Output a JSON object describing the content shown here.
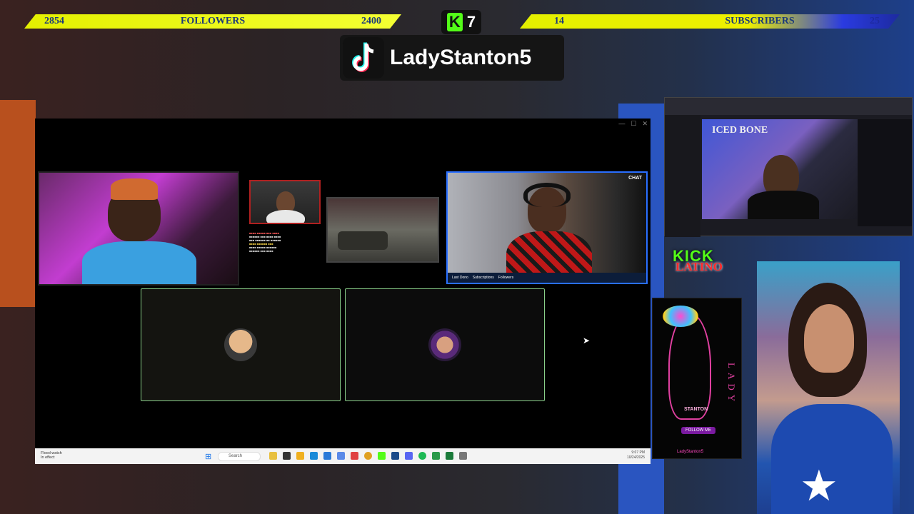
{
  "overlay": {
    "followers_banner": {
      "count_left": "2854",
      "label": "FOLLOWERS",
      "count_right": "2400"
    },
    "kick_badge": {
      "count": "7"
    },
    "subscribers_banner": {
      "count_left": "14",
      "label": "SUBSCRIBERS",
      "count_right": "25"
    },
    "tiktok": {
      "username": "LadyStanton5"
    },
    "kick_latino": {
      "line1": "KICK",
      "line2": "LATINO"
    },
    "lady_panel": {
      "side_text": "LADY",
      "stanton": "STANTON",
      "follow_button": "FOLLOW ME",
      "handle": "LadyStanton5"
    }
  },
  "browser": {
    "channel_overlay": "ICED BONE"
  },
  "desktop": {
    "cam4_bar": [
      "Last Dono",
      "Subscriptions",
      "Followers"
    ],
    "chat_badge": "CHAT",
    "taskbar": {
      "weather_line1": "Flood watch",
      "weather_line2": "In effect",
      "search_placeholder": "Search",
      "time": "9:07 PM",
      "date": "10/24/2025"
    }
  },
  "colors": {
    "banner_yellow": "#e4f000",
    "kick_green": "#53fc18",
    "tiktok_bg": "#151515",
    "panel_border_green": "#8ad08a"
  }
}
